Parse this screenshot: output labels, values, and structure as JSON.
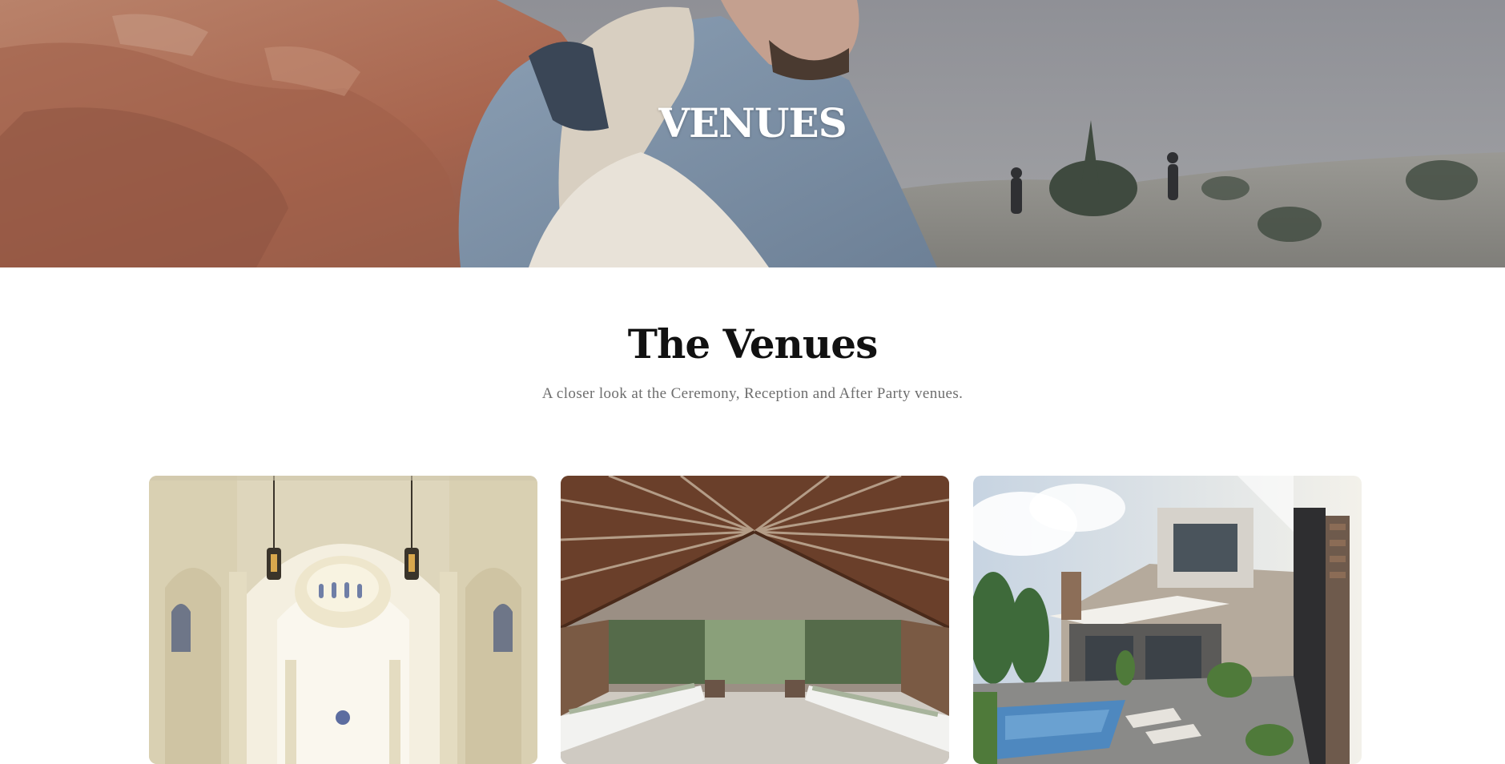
{
  "hero": {
    "title": "VENUES"
  },
  "intro": {
    "title": "The Venues",
    "subtitle": "A closer look at the Ceremony, Reception and After Party venues."
  },
  "venues": [
    {
      "image": "cathedral-interior"
    },
    {
      "image": "timber-pavilion-interior"
    },
    {
      "image": "modern-villa-with-pool"
    }
  ]
}
